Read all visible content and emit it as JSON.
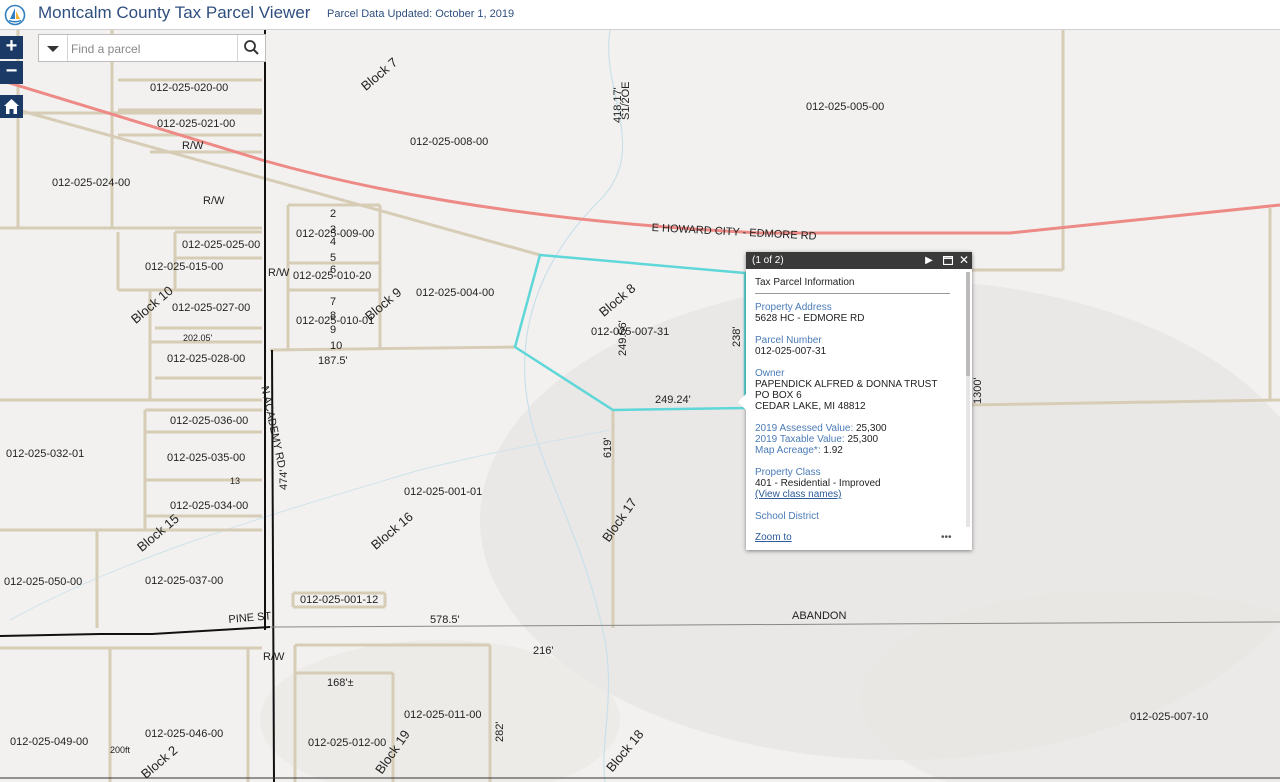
{
  "header": {
    "title": "Montcalm County Tax Parcel Viewer",
    "updated": "Parcel Data Updated: October 1, 2019"
  },
  "controls": {
    "zoom_in": "+",
    "zoom_out": "−",
    "home_icon": "home-icon",
    "search_placeholder": "Find a parcel",
    "search_icon": "search-icon",
    "dropdown_icon": "chevron-down-icon"
  },
  "colors": {
    "road": "#ed8a86",
    "parcel_line": "#d7cdb7",
    "selection": "#5fd7d8",
    "header_text": "#2f4f7f",
    "zoom_button": "#1b3a66"
  },
  "map_labels": {
    "parcels": [
      "012-025-020-00",
      "012-025-021-00",
      "012-025-024-00",
      "012-025-008-00",
      "012-025-005-00",
      "012-025-009-00",
      "012-025-025-00",
      "012-025-015-00",
      "012-025-010-20",
      "012-025-027-00",
      "012-025-010-01",
      "012-025-004-00",
      "012-025-007-31",
      "012-025-028-00",
      "012-025-036-00",
      "012-025-032-01",
      "012-025-035-00",
      "012-025-034-00",
      "012-025-001-01",
      "012-025-050-00",
      "012-025-037-00",
      "012-025-001-12",
      "012-025-011-00",
      "012-025-046-00",
      "012-025-012-00",
      "012-025-049-00",
      "012-025-007-10"
    ],
    "blocks": [
      "Block 7",
      "Block 8",
      "Block 9",
      "Block 10",
      "Block 15",
      "Block 16",
      "Block 17",
      "Block 18",
      "Block 19",
      "Block 2"
    ],
    "roads": [
      "E HOWARD CITY - EDMORE RD",
      "N ACADEMY RD",
      "PINE ST",
      "ABANDON",
      "R/W"
    ],
    "dimensions": [
      "249.24'",
      "238'",
      "249.56'",
      "187.5'",
      "578.5'",
      "216'",
      "168'±",
      "619'",
      "282'",
      "418.17'",
      "474'",
      "202.05'",
      "1300'",
      "200ft",
      "S1/2OE",
      "13"
    ]
  },
  "lot_numbers": [
    "2",
    "3",
    "4",
    "5",
    "6",
    "7",
    "8",
    "9",
    "10"
  ],
  "popup": {
    "counter": "(1 of 2)",
    "next_icon": "next-arrow-icon",
    "maximize_icon": "maximize-icon",
    "close_icon": "close-icon",
    "title": "Tax Parcel Information",
    "address_label": "Property Address",
    "address": "5628 HC - EDMORE RD",
    "parcel_label": "Parcel Number",
    "parcel": "012-025-007-31",
    "owner_label": "Owner",
    "owner_line1": "PAPENDICK ALFRED & DONNA TRUST",
    "owner_line2": "PO BOX 6",
    "owner_line3": "CEDAR LAKE, MI 48812",
    "assessed_label": "2019 Assessed Value:",
    "assessed": "25,300",
    "taxable_label": "2019 Taxable Value:",
    "taxable": "25,300",
    "acreage_label": "Map Acreage*:",
    "acreage": "1.92",
    "class_label": "Property Class",
    "class_value": "401 - Residential - Improved",
    "class_link": "(View class names)",
    "school_label": "School District",
    "zoom_link": "Zoom to",
    "more": "•••"
  }
}
